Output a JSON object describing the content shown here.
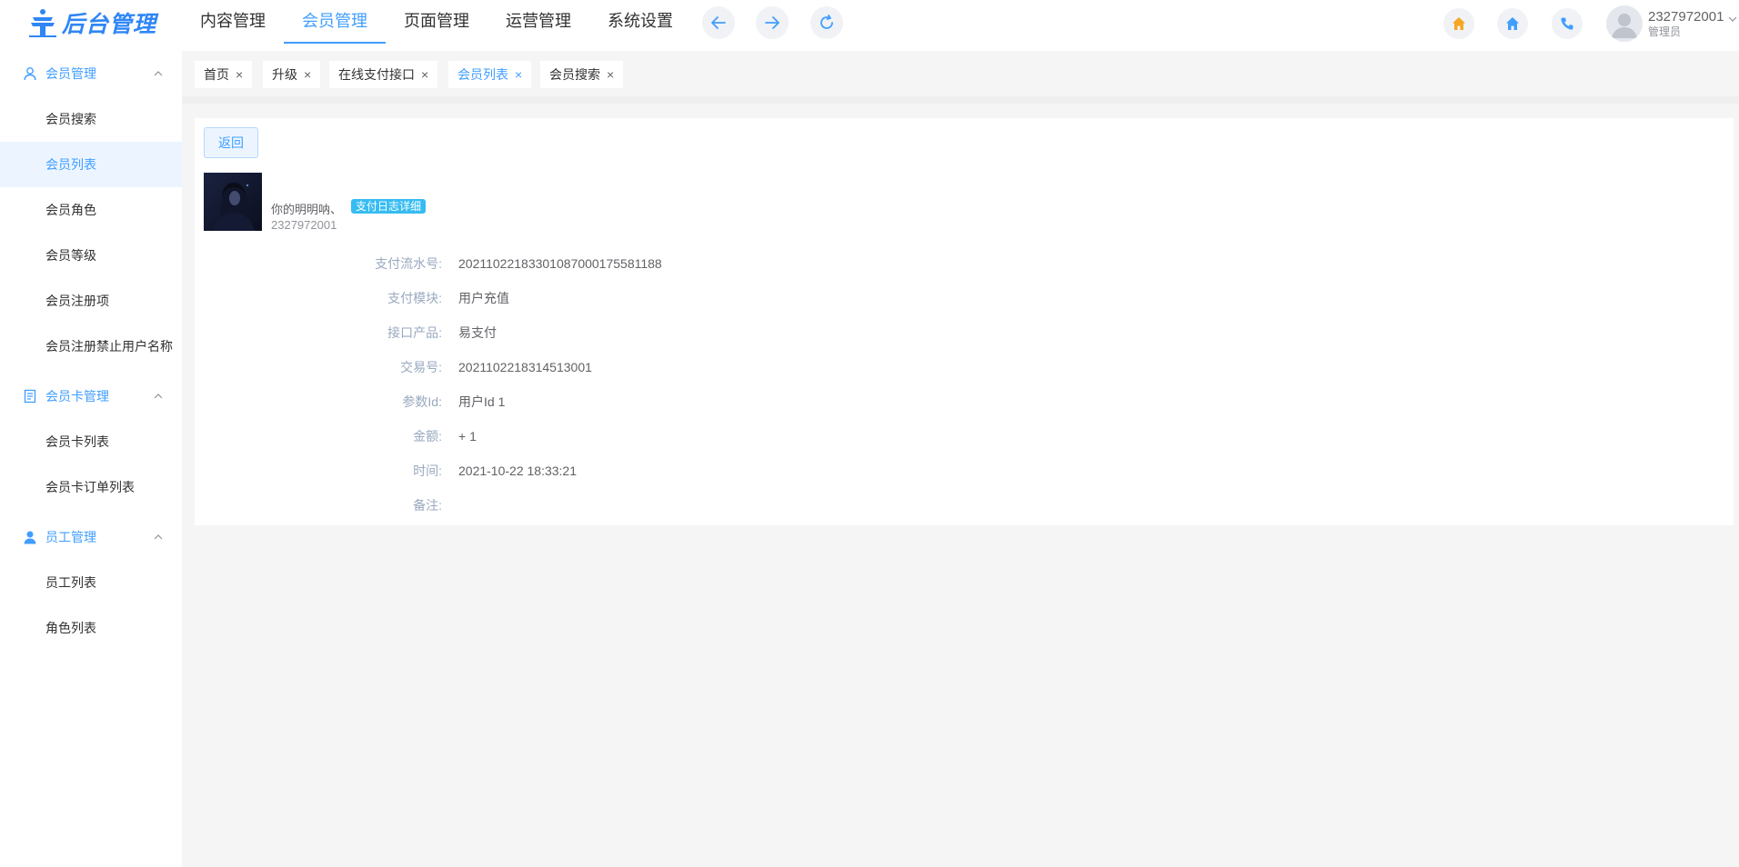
{
  "app": {
    "logo_text": "后台管理"
  },
  "nav": {
    "items": [
      "内容管理",
      "会员管理",
      "页面管理",
      "运营管理",
      "系统设置"
    ],
    "active_index": 1
  },
  "header": {
    "user_name": "2327972001",
    "user_role": "管理员"
  },
  "sidebar": {
    "groups": [
      {
        "title": "会员管理",
        "icon": "user-outline-icon",
        "items": [
          "会员搜索",
          "会员列表",
          "会员角色",
          "会员等级",
          "会员注册项",
          "会员注册禁止用户名称"
        ]
      },
      {
        "title": "会员卡管理",
        "icon": "document-icon",
        "items": [
          "会员卡列表",
          "会员卡订单列表"
        ]
      },
      {
        "title": "员工管理",
        "icon": "user-filled-icon",
        "items": [
          "员工列表",
          "角色列表"
        ]
      }
    ],
    "active_item": "会员列表"
  },
  "tabs": {
    "items": [
      "首页",
      "升级",
      "在线支付接口",
      "会员列表",
      "会员搜索"
    ],
    "active_index": 3
  },
  "detail": {
    "back_label": "返回",
    "member_name": "你的明明呐、",
    "badge": "支付日志详细",
    "member_id": "2327972001",
    "fields": [
      {
        "label": "支付流水号:",
        "value": "20211022183301087000175581188"
      },
      {
        "label": "支付模块:",
        "value": "用户充值"
      },
      {
        "label": "接口产品:",
        "value": "易支付"
      },
      {
        "label": "交易号:",
        "value": "2021102218314513001"
      },
      {
        "label": "参数Id:",
        "value": "用户Id 1"
      },
      {
        "label": "金额:",
        "value": "+ 1"
      },
      {
        "label": "时间:",
        "value": "2021-10-22 18:33:21"
      },
      {
        "label": "备注:",
        "value": ""
      }
    ]
  },
  "colors": {
    "accent": "#409eff",
    "active_bg": "#ecf5ff",
    "badge": "#36bcf2",
    "home_icon_orange": "#f5a623",
    "label_gray": "#99a9bf"
  }
}
